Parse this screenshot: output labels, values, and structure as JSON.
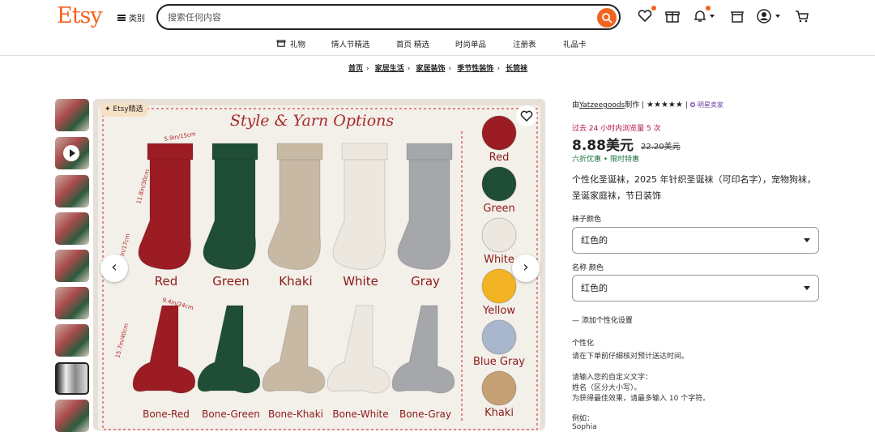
{
  "header": {
    "logo": "Etsy",
    "categories": "类别",
    "search_placeholder": "搜索任何内容"
  },
  "nav": {
    "items": [
      "礼物",
      "情人节精选",
      "首页 精选",
      "时尚单品",
      "注册表",
      "礼品卡"
    ]
  },
  "breadcrumb": [
    "首页",
    "家居生活",
    "家居装饰",
    "季节性装饰",
    "长筒袜"
  ],
  "image": {
    "badge": "Etsy精选",
    "heading": "Style & Yarn Options",
    "stockings": [
      "Red",
      "Green",
      "Khaki",
      "White",
      "Gray"
    ],
    "bones": [
      "Bone-Red",
      "Bone-Green",
      "Bone-Khaki",
      "Bone-White",
      "Bone-Gray"
    ],
    "yarns": [
      "Red",
      "Green",
      "White",
      "Yellow",
      "Blue Gray",
      "Khaki"
    ],
    "dim1": "5.9in/15cm",
    "dim2": "11.8in/30cm",
    "dim3": "6.7in/17cm",
    "dim4": "9.4in/24cm",
    "dim5": "15.7in/40cm",
    "colors": {
      "red": "#9c1c24",
      "green": "#1f4d35",
      "khaki": "#c8b9a5",
      "white": "#ede8df",
      "gray": "#a6a7ab",
      "yellow": "#f2b424",
      "bluegray": "#a9b7cd",
      "kh2": "#c4a074"
    }
  },
  "product": {
    "shop_prefix": "由",
    "shop": "Yatzeegoods",
    "shop_suffix": "制作",
    "stars": "★★★★★",
    "star_seller": "明星卖家",
    "sales": "过去 24 小时内浏览量 5 次",
    "price": "8.88美元",
    "old_price": "22.20美元",
    "discount": "六折优惠 • 限时特惠",
    "title": "个性化圣诞袜，2025 年针织圣诞袜（可印名字），宠物狗袜，圣诞家庭袜，节日装饰",
    "opt1_label": "袜子颜色",
    "opt1_value": "红色的",
    "opt2_label": "名称 颜色",
    "opt2_value": "红色的",
    "add_personal": "添加个性化设置",
    "pers_label": "个性化",
    "pers_note": "请在下单前仔细核对预计送达时间。",
    "instr1": "请输入您的自定义文字：",
    "instr2": "姓名（区分大小写）。",
    "instr3": "为获得最佳效果，请最多输入 10 个字符。",
    "example_label": "例如：",
    "example_value": "Sophia"
  }
}
